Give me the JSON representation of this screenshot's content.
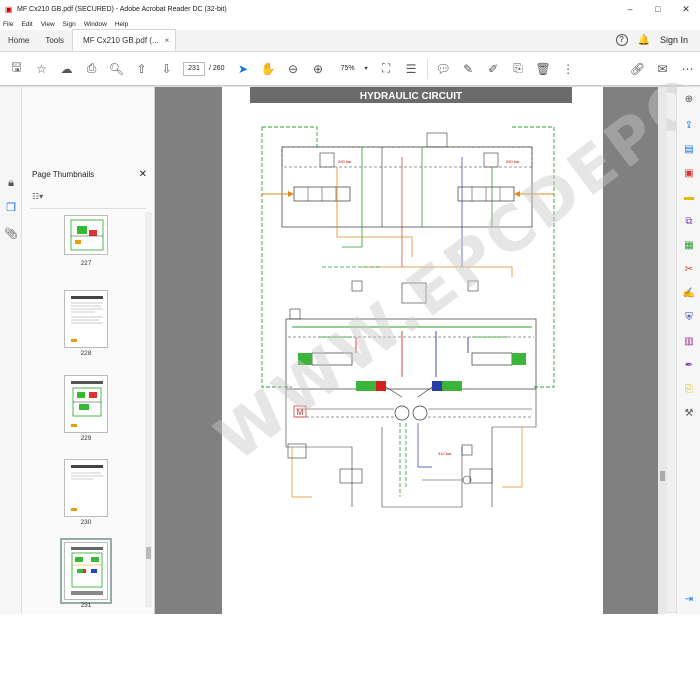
{
  "window": {
    "title": "MF Cx210 GB.pdf (SECURED) - Adobe Acrobat Reader DC (32-bit)",
    "minimize": "–",
    "maximize": "□",
    "close": "✕"
  },
  "menu": [
    "File",
    "Edit",
    "View",
    "Sign",
    "Window",
    "Help"
  ],
  "tabs": {
    "home": "Home",
    "tools": "Tools",
    "doc": "MF Cx210 GB.pdf (...",
    "close": "×",
    "sign_in": "Sign In"
  },
  "toolbar": {
    "current_page": "231",
    "total_pages": "/ 260",
    "zoom": "75%"
  },
  "thumbnails": {
    "title": "Page Thumbnails",
    "pages": [
      "227",
      "228",
      "229",
      "230",
      "231"
    ]
  },
  "document": {
    "heading": "HYDRAULIC CIRCUIT",
    "labels": {
      "pressure_left": "290 bar",
      "pressure_right": "290 bar",
      "pump_pressure": "310 bar",
      "m": "M"
    }
  },
  "watermark": "WWW.EPCDEPO.COM",
  "colors": {
    "accent": "#1473e6",
    "heading_bar": "#6b6b6b",
    "doc_bg": "#808080"
  }
}
